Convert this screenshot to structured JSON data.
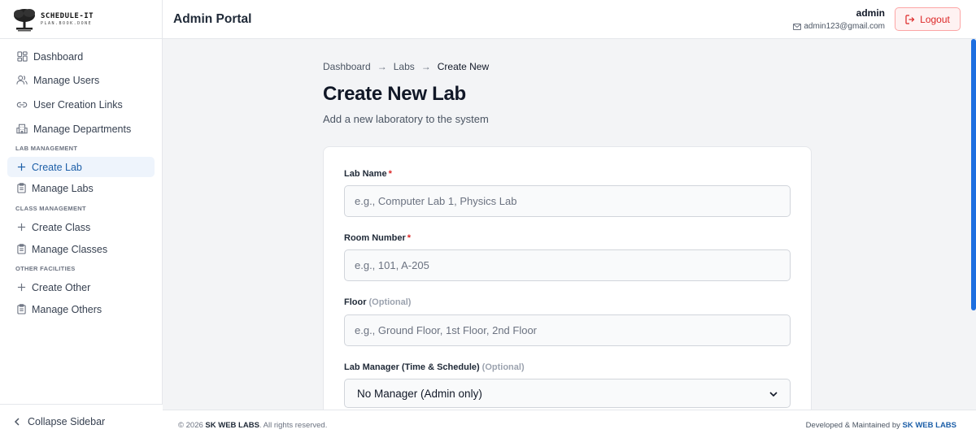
{
  "brand": {
    "name": "SCHEDULE-IT",
    "tagline": "PLAN.BOOK.DONE"
  },
  "sidebar": {
    "items": [
      {
        "label": "Dashboard",
        "icon": "dashboard-icon"
      },
      {
        "label": "Manage Users",
        "icon": "users-icon"
      },
      {
        "label": "User Creation Links",
        "icon": "link-icon"
      },
      {
        "label": "Manage Departments",
        "icon": "building-icon"
      }
    ],
    "sections": [
      {
        "title": "LAB MANAGEMENT",
        "items": [
          {
            "label": "Create Lab",
            "icon": "plus-icon",
            "active": true
          },
          {
            "label": "Manage Labs",
            "icon": "clipboard-icon"
          }
        ]
      },
      {
        "title": "CLASS MANAGEMENT",
        "items": [
          {
            "label": "Create Class",
            "icon": "plus-icon"
          },
          {
            "label": "Manage Classes",
            "icon": "clipboard-icon"
          }
        ]
      },
      {
        "title": "OTHER FACILITIES",
        "items": [
          {
            "label": "Create Other",
            "icon": "plus-icon"
          },
          {
            "label": "Manage Others",
            "icon": "clipboard-icon"
          }
        ]
      }
    ],
    "collapse_label": "Collapse Sidebar"
  },
  "header": {
    "title": "Admin Portal",
    "user_name": "admin",
    "user_email": "admin123@gmail.com",
    "logout_label": "Logout"
  },
  "breadcrumb": [
    "Dashboard",
    "Labs",
    "Create New"
  ],
  "breadcrumb_separator": "→",
  "page": {
    "title": "Create New Lab",
    "subtitle": "Add a new laboratory to the system"
  },
  "form": {
    "lab_name": {
      "label": "Lab Name",
      "required": "*",
      "placeholder": "e.g., Computer Lab 1, Physics Lab",
      "value": ""
    },
    "room_number": {
      "label": "Room Number",
      "required": "*",
      "placeholder": "e.g., 101, A-205",
      "value": ""
    },
    "floor": {
      "label": "Floor",
      "optional": "(Optional)",
      "placeholder": "e.g., Ground Floor, 1st Floor, 2nd Floor",
      "value": ""
    },
    "lab_manager": {
      "label": "Lab Manager (Time & Schedule)",
      "optional": "(Optional)",
      "selected": "No Manager (Admin only)"
    }
  },
  "footer": {
    "copyright_prefix": "© 2026",
    "company": "SK WEB LABS",
    "rights": ". All rights reserved.",
    "developed_by": "Developed & Maintained by",
    "developer": "SK WEB LABS"
  },
  "colors": {
    "accent": "#1d5fa8",
    "danger": "#dc2626",
    "scrollbar": "#1d6fe0"
  }
}
